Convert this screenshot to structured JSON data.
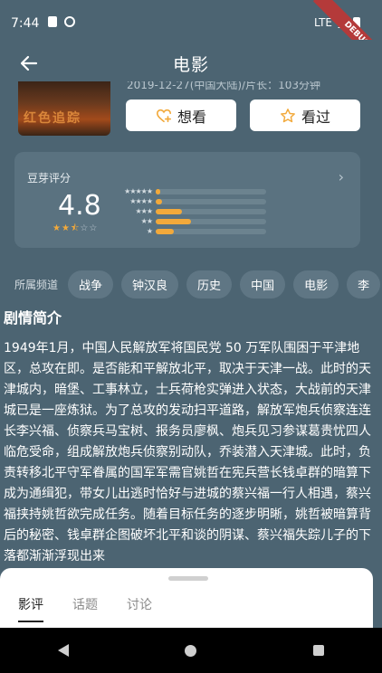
{
  "status_bar": {
    "time": "7:44",
    "network": "LTE",
    "icons": [
      "sd-card-icon",
      "sync-icon",
      "signal-icon",
      "battery-icon"
    ]
  },
  "debug_banner": "DEBUG",
  "header": {
    "title": "电影",
    "back_icon": "arrow-left-icon"
  },
  "movie": {
    "meta_partial": "2019-12-27(中国大陆)/片长：103分钟",
    "poster_text": "红色追踪",
    "actions": [
      {
        "label": "想看",
        "icon": "heart-plus-icon"
      },
      {
        "label": "看过",
        "icon": "star-outline-icon"
      }
    ]
  },
  "rating": {
    "title": "豆芽评分",
    "score": "4.8",
    "stars_filled": 2.5,
    "stars_total": 5,
    "distribution": [
      {
        "stars": "★★★★★",
        "fraction": 0.04
      },
      {
        "stars": "★★★★",
        "fraction": 0.06
      },
      {
        "stars": "★★★",
        "fraction": 0.24
      },
      {
        "stars": "★★",
        "fraction": 0.32
      },
      {
        "stars": "★",
        "fraction": 0.16
      }
    ],
    "accent_color": "#f2a93b"
  },
  "channels": {
    "label": "所属频道",
    "items": [
      "战争",
      "钟汉良",
      "历史",
      "中国",
      "电影",
      "李"
    ]
  },
  "synopsis": {
    "title": "剧情简介",
    "text": "1949年1月，中国人民解放军将国民党 50 万军队围困于平津地区，总攻在即。是否能和平解放北平，取决于天津一战。此时的天津城内，暗堡、工事林立，士兵荷枪实弹进入状态，大战前的天津城已是一座炼狱。为了总攻的发动扫平道路，解放军炮兵侦察连连长李兴福、侦察兵马宝树、报务员廖枫、炮兵见习参谋葛贵忧四人临危受命，组成解放炮兵侦察别动队，乔装潜入天津城。此时，负责转移北平守军眷属的国军军需官姚哲在宪兵营长钱卓群的暗算下成为通缉犯，带女儿出逃时恰好与进城的蔡兴福一行人相遇，蔡兴福挟持姚哲欲完成任务。随着目标任务的逐步明晰，姚哲被暗算背后的秘密、钱卓群企图破坏北平和谈的阴谋、蔡兴福失踪儿子的下落都渐渐浮现出来"
  },
  "bottom_sheet": {
    "tabs": [
      "影评",
      "话题",
      "讨论"
    ],
    "active_tab": "影评"
  },
  "nav_bar": {
    "buttons": [
      "back-icon",
      "home-icon",
      "recents-icon"
    ]
  }
}
